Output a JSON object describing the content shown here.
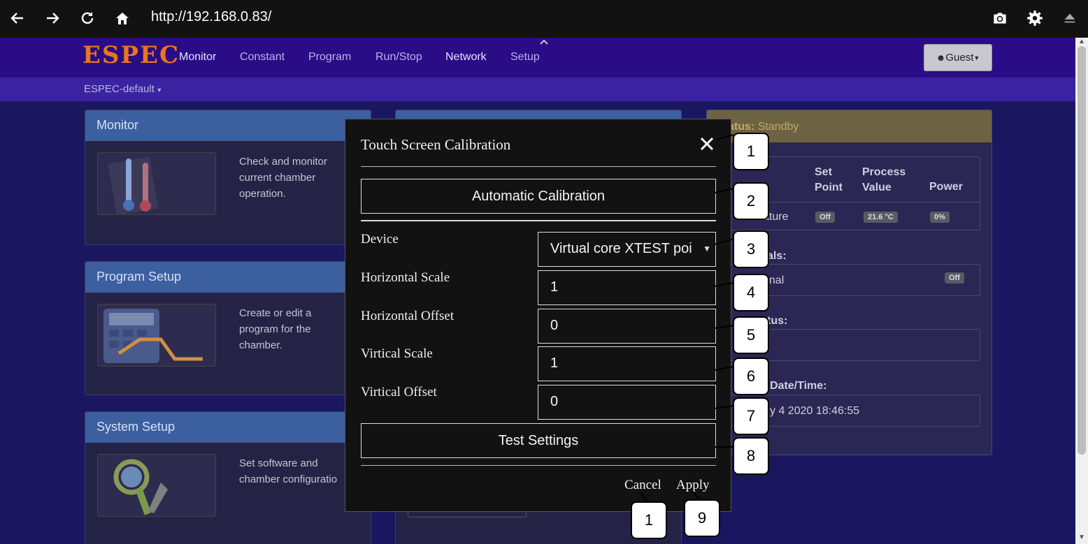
{
  "browser": {
    "url": "http://192.168.0.83/",
    "icons": [
      "back-icon",
      "forward-icon",
      "reload-icon",
      "home-icon",
      "camera-icon",
      "gear-icon",
      "eject-icon"
    ]
  },
  "navbar": {
    "logo": "ESPEC",
    "items": [
      "Monitor",
      "Constant",
      "Program",
      "Run/Stop",
      "Network",
      "Setup"
    ],
    "user_button": "Guest",
    "profile": "ESPEC-default"
  },
  "panels": [
    {
      "title": "Monitor",
      "desc": "Check and monitor current chamber operation."
    },
    {
      "title": "Program Setup",
      "desc": "Create or edit a program for the chamber."
    },
    {
      "title": "System Setup",
      "desc": "Set software and chamber configuratio"
    }
  ],
  "status_panel": {
    "status_label": "atus:",
    "status_value": "Standby",
    "col_setpoint": "Set Point",
    "col_process": "Process Value",
    "col_power": "Power",
    "row_label": "ature",
    "setpoint_val": "Off",
    "process_val": "21.6 °C",
    "power_val": "0%",
    "signals_label": "als:",
    "signal_row": "gnal",
    "signal_val": "Off",
    "status2_label": "tus:",
    "datetime_label": "Date/Time:",
    "datetime_val": "y 4 2020 18:46:55"
  },
  "modal": {
    "title": "Touch Screen Calibration",
    "auto_calibration": "Automatic Calibration",
    "device_label": "Device",
    "device_value": "Virtual core XTEST poi",
    "hscale_label": "Horizontal Scale",
    "hscale_value": "1",
    "hoffset_label": "Horizontal Offset",
    "hoffset_value": "0",
    "vscale_label": "Virtical Scale",
    "vscale_value": "1",
    "voffset_label": "Virtical Offset",
    "voffset_value": "0",
    "test_settings": "Test Settings",
    "cancel": "Cancel",
    "apply": "Apply"
  },
  "callouts": [
    "1",
    "2",
    "3",
    "4",
    "5",
    "6",
    "7",
    "8",
    "1",
    "9"
  ]
}
